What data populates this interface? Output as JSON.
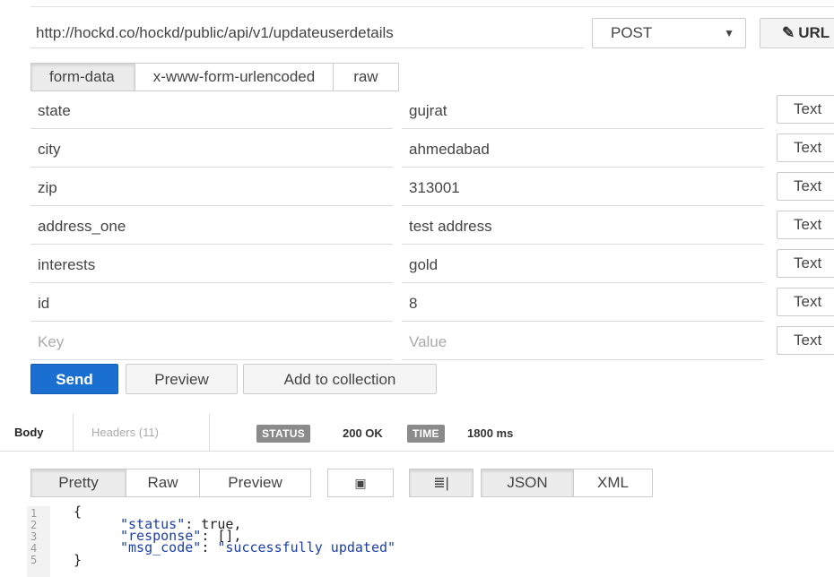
{
  "request": {
    "url": "http://hockd.co/hockd/public/api/v1/updateuserdetails",
    "method": "POST",
    "url_params_label": "URL"
  },
  "body_tabs": [
    "form-data",
    "x-www-form-urlencoded",
    "raw"
  ],
  "params": [
    {
      "key": "state",
      "value": "gujrat",
      "type": "Text"
    },
    {
      "key": "city",
      "value": "ahmedabad",
      "type": "Text"
    },
    {
      "key": "zip",
      "value": "313001",
      "type": "Text"
    },
    {
      "key": "address_one",
      "value": "test address",
      "type": "Text"
    },
    {
      "key": "interests",
      "value": "gold",
      "type": "Text"
    },
    {
      "key": "id",
      "value": "8",
      "type": "Text"
    }
  ],
  "new_param": {
    "key_placeholder": "Key",
    "value_placeholder": "Value",
    "type": "Text"
  },
  "actions": {
    "send": "Send",
    "preview": "Preview",
    "add_to_collection": "Add to collection"
  },
  "response": {
    "tabs": {
      "body": "Body",
      "headers": "Headers (11)"
    },
    "status_label": "STATUS",
    "status_value": "200 OK",
    "time_label": "TIME",
    "time_value": "1800 ms",
    "format_buttons": [
      "Pretty",
      "Raw",
      "Preview"
    ],
    "language_buttons": [
      "JSON",
      "XML"
    ],
    "line_numbers": [
      "1",
      "2",
      "3",
      "4",
      "5"
    ],
    "code": {
      "open": "{",
      "line2_key": "\"status\"",
      "line2_val": " true,",
      "line3_key": "\"response\"",
      "line3_val": " [],",
      "line4_key": "\"msg_code\"",
      "line4_val": "\"successfully updated\"",
      "close": "}"
    }
  },
  "colors": {
    "send": "#1b6fd0",
    "status_badge": "#8a8a8a"
  }
}
